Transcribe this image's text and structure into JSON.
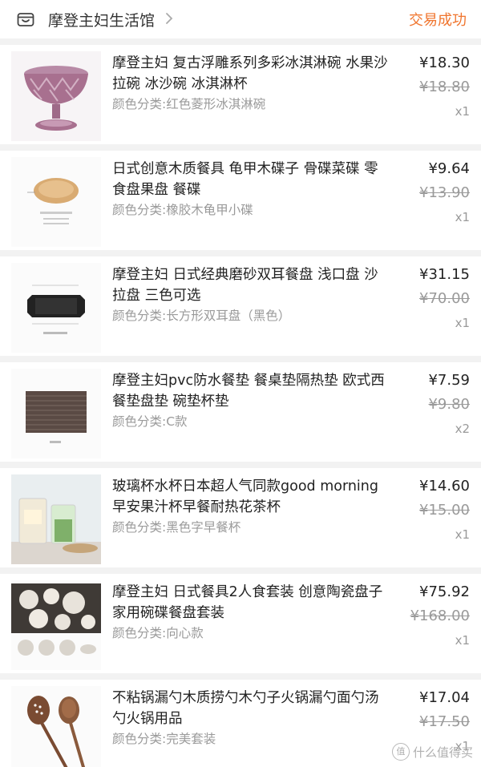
{
  "header": {
    "shop_name": "摩登主妇生活馆",
    "status": "交易成功",
    "status_color": "#f0752e",
    "shop_icon": "storefront-icon",
    "chevron_icon": "chevron-right-icon"
  },
  "items": [
    {
      "title": "摩登主妇 复古浮雕系列多彩冰淇淋碗 水果沙拉碗 冰沙碗 冰淇淋杯",
      "variant": "颜色分类:红色菱形冰淇淋碗",
      "price": "¥18.30",
      "original_price": "¥18.80",
      "quantity": "x1",
      "thumb_icon": "pink-glass-dessert-bowl-image"
    },
    {
      "title": "日式创意木质餐具 龟甲木碟子 骨碟菜碟 零食盘果盘 餐碟",
      "variant": "颜色分类:橡胶木龟甲小碟",
      "price": "¥9.64",
      "original_price": "¥13.90",
      "quantity": "x1",
      "thumb_icon": "wooden-plate-image"
    },
    {
      "title": "摩登主妇 日式经典磨砂双耳餐盘 浅口盘 沙拉盘 三色可选",
      "variant": "颜色分类:长方形双耳盘（黑色）",
      "price": "¥31.15",
      "original_price": "¥70.00",
      "quantity": "x1",
      "thumb_icon": "black-rectangular-plate-image"
    },
    {
      "title": "摩登主妇pvc防水餐垫 餐桌垫隔热垫 欧式西餐垫盘垫 碗垫杯垫",
      "variant": "颜色分类:C款",
      "price": "¥7.59",
      "original_price": "¥9.80",
      "quantity": "x2",
      "thumb_icon": "placemat-image"
    },
    {
      "title": "玻璃杯水杯日本超人气同款good morning早安果汁杯早餐耐热花茶杯",
      "variant": "颜色分类:黑色字早餐杯",
      "price": "¥14.60",
      "original_price": "¥15.00",
      "quantity": "x1",
      "thumb_icon": "glass-cup-image"
    },
    {
      "title": "摩登主妇 日式餐具2人食套装 创意陶瓷盘子家用碗碟餐盘套装",
      "variant": "颜色分类:向心款",
      "price": "¥75.92",
      "original_price": "¥168.00",
      "quantity": "x1",
      "thumb_icon": "ceramic-tableware-set-image"
    },
    {
      "title": "不粘锅漏勺木质捞勺木勺子火锅漏勺面勺汤勺火锅用品",
      "variant": "颜色分类:完美套装",
      "price": "¥17.04",
      "original_price": "¥17.50",
      "quantity": "x1",
      "thumb_icon": "wooden-ladles-image"
    }
  ],
  "watermark": {
    "badge": "值",
    "text": "什么值得买"
  }
}
